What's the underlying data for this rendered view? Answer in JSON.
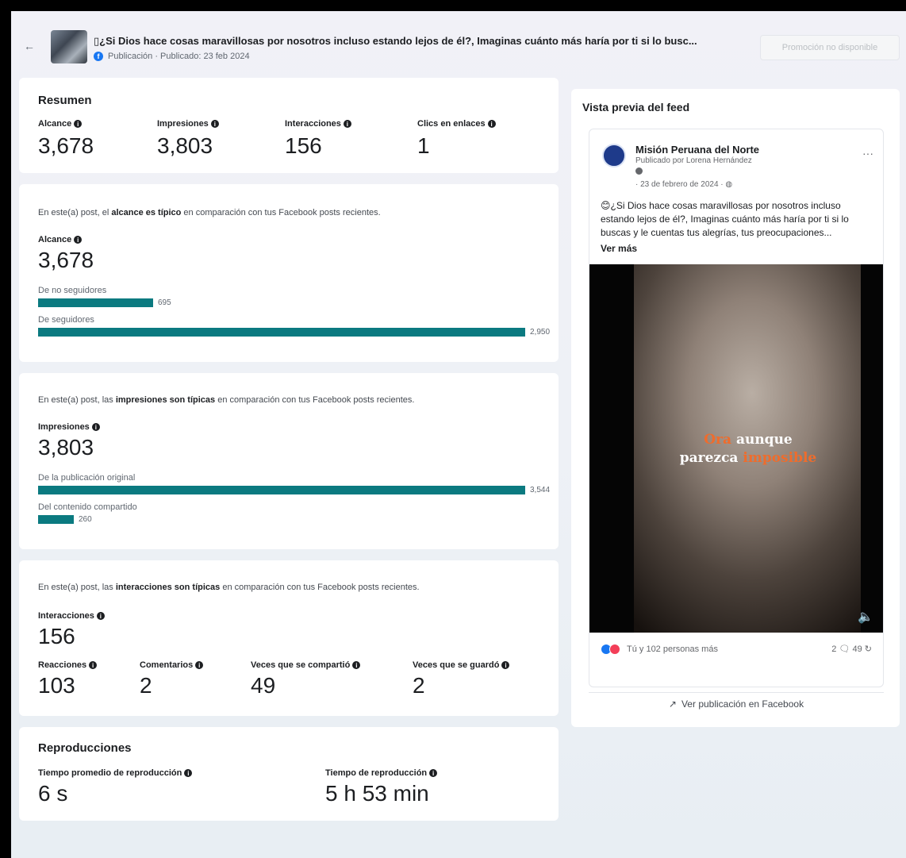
{
  "header": {
    "back": "←",
    "title": "▯¿Si Dios hace cosas maravillosas por nosotros incluso estando lejos de él?, Imaginas cuánto más haría por ti si lo busc...",
    "type_label": "Publicación · Publicado: 23 feb 2024",
    "promo_button": "Promoción no disponible"
  },
  "summary": {
    "title": "Resumen",
    "metrics": [
      {
        "label": "Alcance",
        "value": "3,678"
      },
      {
        "label": "Impresiones",
        "value": "3,803"
      },
      {
        "label": "Interacciones",
        "value": "156"
      },
      {
        "label": "Clics en enlaces",
        "value": "1"
      }
    ]
  },
  "reach": {
    "note_pre": "En este(a) post, el ",
    "note_bold": "alcance es típico",
    "note_post": " en comparación con tus Facebook posts recientes.",
    "label": "Alcance",
    "value": "3,678",
    "bars": [
      {
        "label": "De no seguidores",
        "value": "695",
        "num": 695
      },
      {
        "label": "De seguidores",
        "value": "2,950",
        "num": 2950
      }
    ]
  },
  "impressions": {
    "note_pre": "En este(a) post, las ",
    "note_bold": "impresiones son típicas",
    "note_post": " en comparación con tus Facebook posts recientes.",
    "label": "Impresiones",
    "value": "3,803",
    "bars": [
      {
        "label": "De la publicación original",
        "value": "3,544",
        "num": 3544
      },
      {
        "label": "Del contenido compartido",
        "value": "260",
        "num": 260
      }
    ]
  },
  "interactions": {
    "note_pre": "En este(a) post, las ",
    "note_bold": "interacciones son típicas",
    "note_post": " en comparación con tus Facebook posts recientes.",
    "label": "Interacciones",
    "value": "156",
    "metrics": [
      {
        "label": "Reacciones",
        "value": "103"
      },
      {
        "label": "Comentarios",
        "value": "2"
      },
      {
        "label": "Veces que se compartió",
        "value": "49"
      },
      {
        "label": "Veces que se guardó",
        "value": "2"
      }
    ]
  },
  "plays": {
    "title": "Reproducciones",
    "metrics": [
      {
        "label": "Tiempo promedio de reproducción",
        "value": "6 s"
      },
      {
        "label": "Tiempo de reproducción",
        "value": "5 h 53 min"
      }
    ]
  },
  "preview": {
    "title": "Vista previa del feed",
    "page_name": "Misión Peruana del Norte",
    "posted_by": "Publicado por Lorena Hernández",
    "date": "· 23 de febrero de 2024 · ",
    "more": "···",
    "text": "😊¿Si Dios hace cosas maravillosas por nosotros incluso estando lejos de él?, Imaginas cuánto más haría por ti si lo buscas y le cuentas tus alegrías, tus preocupaciones...",
    "see_more": "Ver más",
    "overlay_1": "Ora",
    "overlay_2": " aunque",
    "overlay_3": "parezca ",
    "overlay_4": "imposible",
    "reactions_text": "Tú y 102 personas más",
    "counts": "2 🗨  49 ↻",
    "view_link": "Ver publicación en Facebook"
  }
}
